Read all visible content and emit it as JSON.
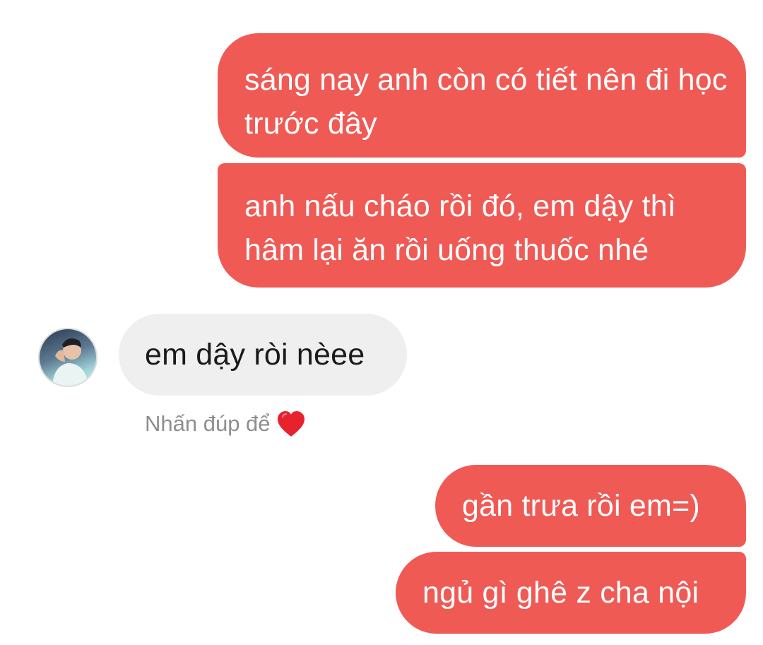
{
  "messages": [
    {
      "id": "msg1",
      "direction": "sent",
      "text": "sáng nay anh còn có tiết nên đi học trước đây"
    },
    {
      "id": "msg2",
      "direction": "sent",
      "text": "anh nấu cháo rồi đó, em dậy thì hâm lại ăn rồi uống thuốc nhé"
    },
    {
      "id": "msg3",
      "direction": "received",
      "text": "em dậy ròi nèee"
    },
    {
      "id": "msg4",
      "direction": "sent",
      "text": "gần trưa rồi em=)"
    },
    {
      "id": "msg5",
      "direction": "sent",
      "text": "ngủ gì ghê z cha nội"
    }
  ],
  "like_hint": {
    "text": "Nhấn đúp để",
    "icon": "heart-icon"
  },
  "colors": {
    "sent_bubble": "#f05a55",
    "received_bubble": "#efefef",
    "heart": "#e8212e",
    "hint_text": "#8e8e8e"
  }
}
